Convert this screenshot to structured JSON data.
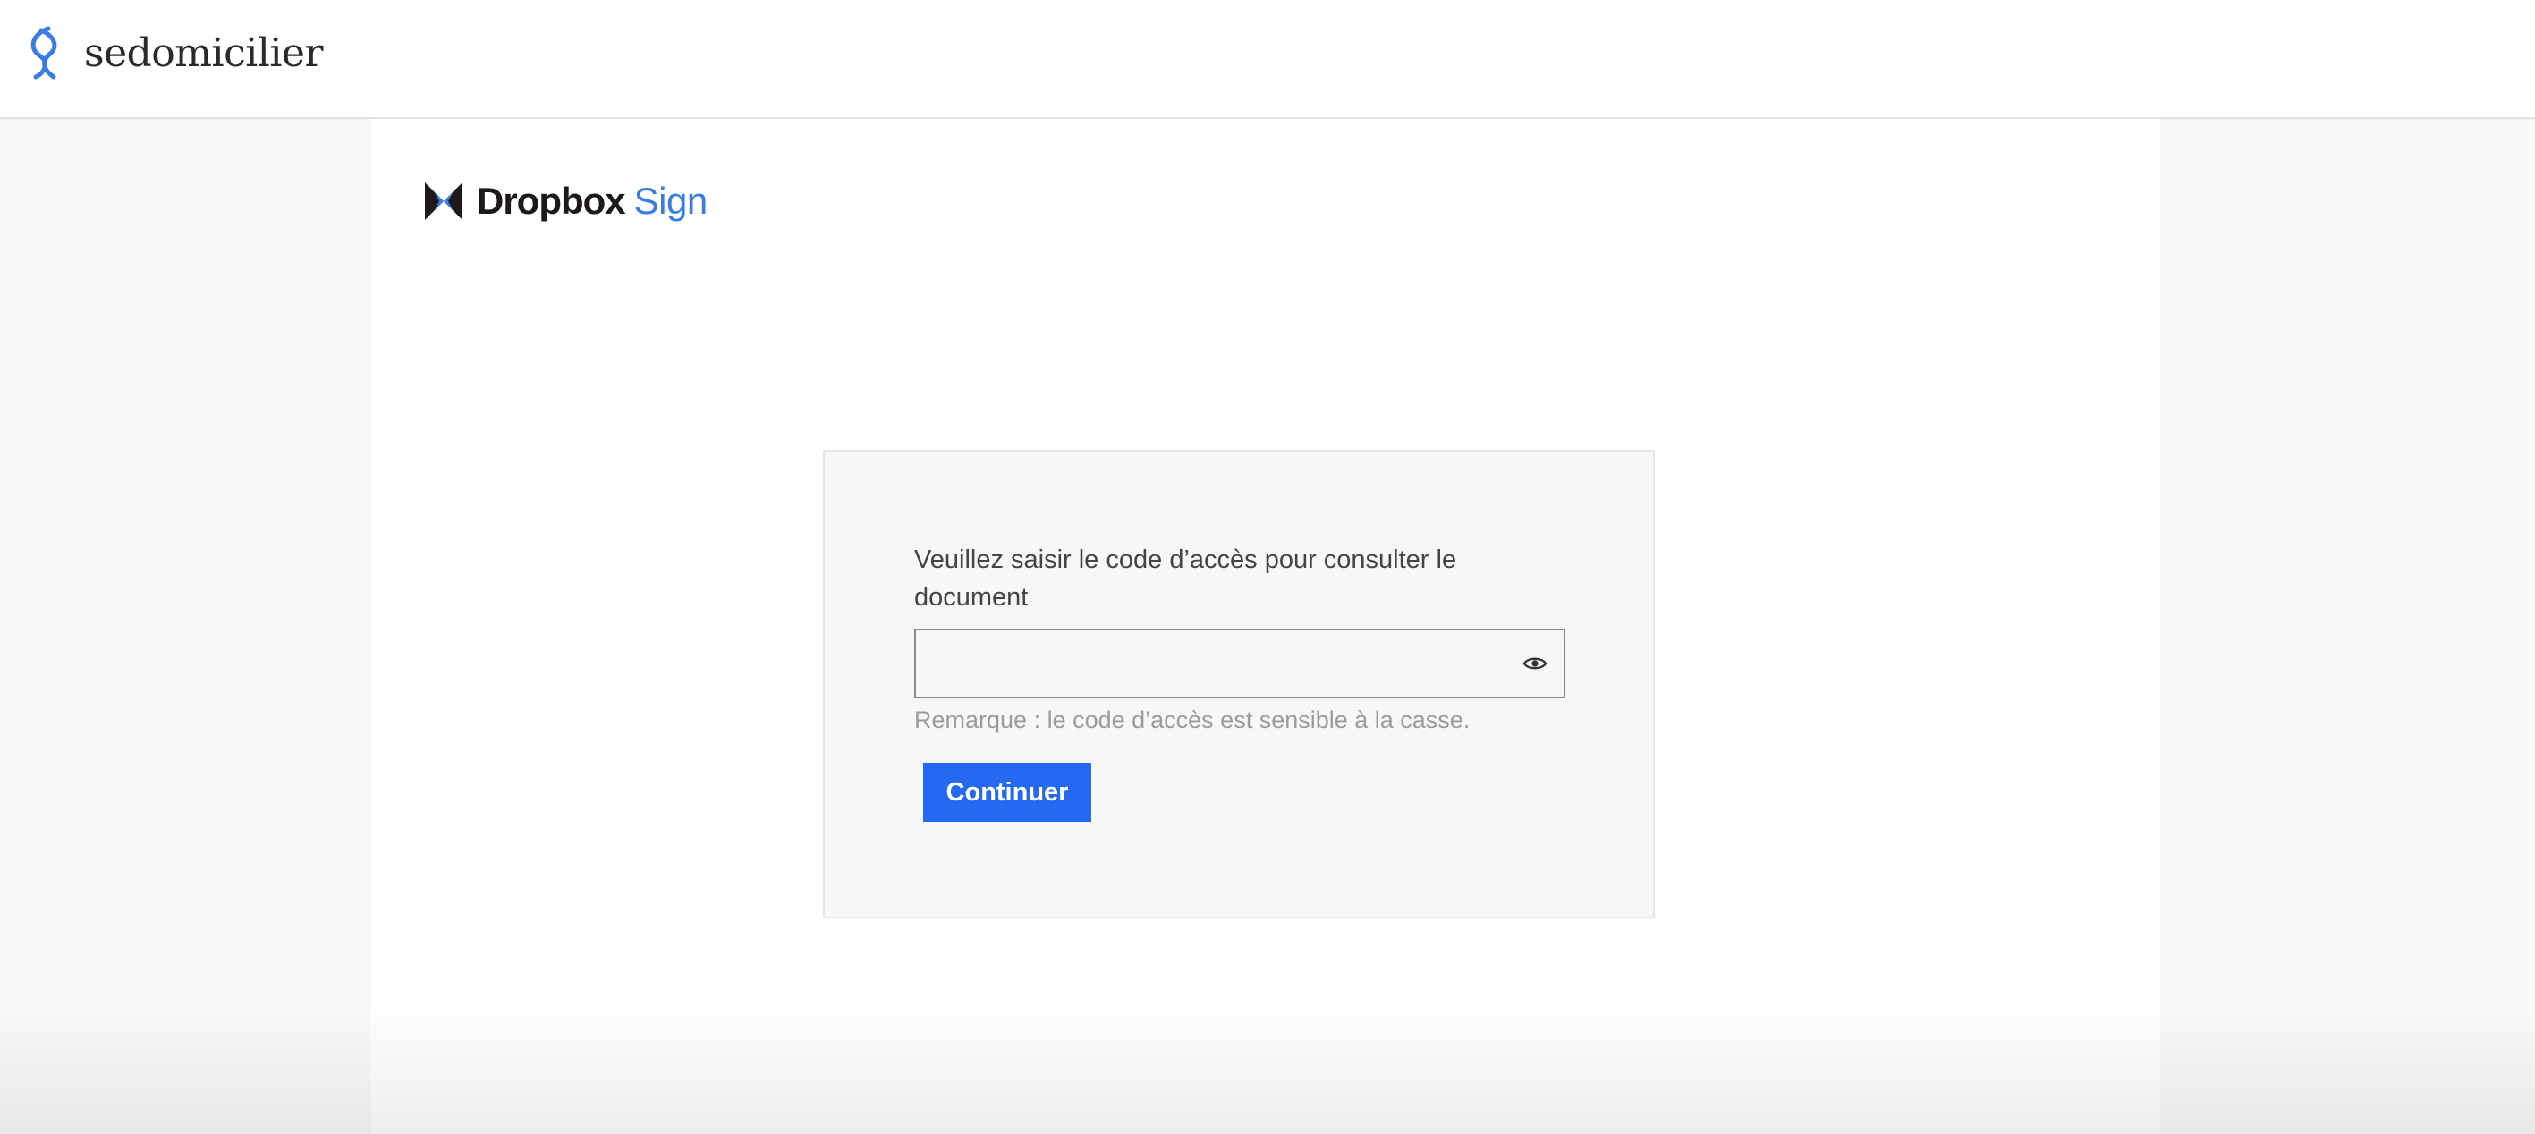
{
  "header": {
    "brand_name": "sedomicilier",
    "brand_icon": "sedomicilier-logo-icon",
    "brand_color": "#3a7de0"
  },
  "provider": {
    "word": "Dropbox",
    "sign": "Sign",
    "mark_icon": "dropbox-sign-logo-icon",
    "mark_colors": [
      "#1e1919",
      "#3a7de0"
    ]
  },
  "access_form": {
    "prompt": "Veuillez saisir le code d’accès pour consulter le document",
    "code_value": "",
    "toggle_icon": "eye-icon",
    "hint": "Remarque : le code d’accès est sensible à la casse.",
    "continue_label": "Continuer",
    "button_color": "#2469f0"
  }
}
